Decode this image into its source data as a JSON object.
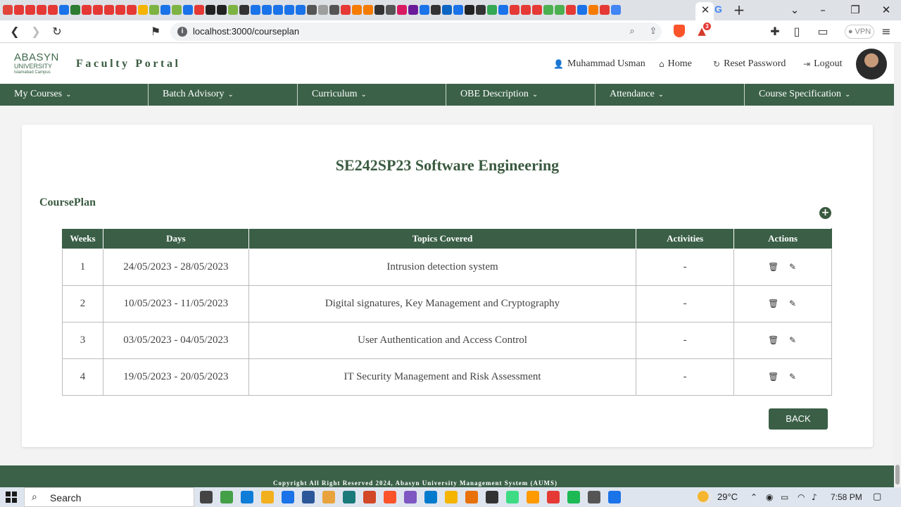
{
  "browser": {
    "url": "localhost:3000/courseplan",
    "vpn_label": "VPN",
    "rewards_badge": "3",
    "tab_close": "✕",
    "new_tab": "+",
    "tab_strip_colors": [
      "#e0443a",
      "#e53935",
      "#e53935",
      "#e53935",
      "#e53935",
      "#1a73e8",
      "#2e7d32",
      "#e53935",
      "#e53935",
      "#e53935",
      "#e53935",
      "#e53935",
      "#f4b400",
      "#7cb342",
      "#1a73e8",
      "#7cb342",
      "#1a73e8",
      "#e53935",
      "#222222",
      "#222222",
      "#7cb342",
      "#333333",
      "#1a73e8",
      "#1a73e8",
      "#1a73e8",
      "#1a73e8",
      "#1a73e8",
      "#555555",
      "#9e9e9e",
      "#555555",
      "#e53935",
      "#f57c00",
      "#f57c00",
      "#333333",
      "#555555",
      "#d81b60",
      "#6a1b9a",
      "#1a73e8",
      "#333333",
      "#0a66c2",
      "#1a73e8",
      "#222222",
      "#333333",
      "#34a853",
      "#1a73e8",
      "#e53935",
      "#e53935",
      "#e53935",
      "#4caf50",
      "#4caf50",
      "#e53935",
      "#1a73e8",
      "#f57c00",
      "#e53935",
      "#4285f4"
    ]
  },
  "header": {
    "logo": {
      "line1": "ABASYN",
      "line2": "UNIVERSITY",
      "line3": "Islamabad Campus"
    },
    "portal_title": "Faculty Portal",
    "user_name": "Muhammad Usman",
    "home_label": "Home",
    "reset_label": "Reset Password",
    "logout_label": "Logout"
  },
  "nav": {
    "items": [
      {
        "label": "My Courses"
      },
      {
        "label": "Batch Advisory"
      },
      {
        "label": "Curriculum"
      },
      {
        "label": "OBE Description"
      },
      {
        "label": "Attendance"
      },
      {
        "label": "Course Specification"
      }
    ]
  },
  "main": {
    "course_title": "SE242SP23 Software Engineering",
    "section_title": "CoursePlan",
    "add_label": "+",
    "table": {
      "headers": [
        "Weeks",
        "Days",
        "Topics Covered",
        "Activities",
        "Actions"
      ],
      "rows": [
        {
          "week": "1",
          "days": "24/05/2023 - 28/05/2023",
          "topic": "Intrusion detection system",
          "activities": "-"
        },
        {
          "week": "2",
          "days": "10/05/2023 - 11/05/2023",
          "topic": "Digital signatures, Key Management and Cryptography",
          "activities": "-"
        },
        {
          "week": "3",
          "days": "03/05/2023 - 04/05/2023",
          "topic": "User Authentication and Access Control",
          "activities": "-"
        },
        {
          "week": "4",
          "days": "19/05/2023 - 20/05/2023",
          "topic": "IT Security Management and Risk Assessment",
          "activities": "-"
        }
      ]
    },
    "back_label": "BACK"
  },
  "footer": {
    "text": "Copyright All Right Reserved 2024, Abasyn University Management System (AUMS)"
  },
  "taskbar": {
    "search_label": "Search",
    "weather": "29°C",
    "time": "7:58 PM",
    "app_colors": [
      "#444444",
      "#43a047",
      "#0f7cd8",
      "#f2b01e",
      "#1a73e8",
      "#2b579a",
      "#e8a33c",
      "#1a7a7a",
      "#d24726",
      "#fb542b",
      "#7e57c2",
      "#007acc",
      "#f4b400",
      "#e8710a",
      "#333333",
      "#3ddc84",
      "#ff9a00",
      "#e53935",
      "#1db954",
      "#555555",
      "#1a73e8"
    ]
  },
  "colors": {
    "primary_green": "#3b6148",
    "title_green": "#3a5a40"
  }
}
